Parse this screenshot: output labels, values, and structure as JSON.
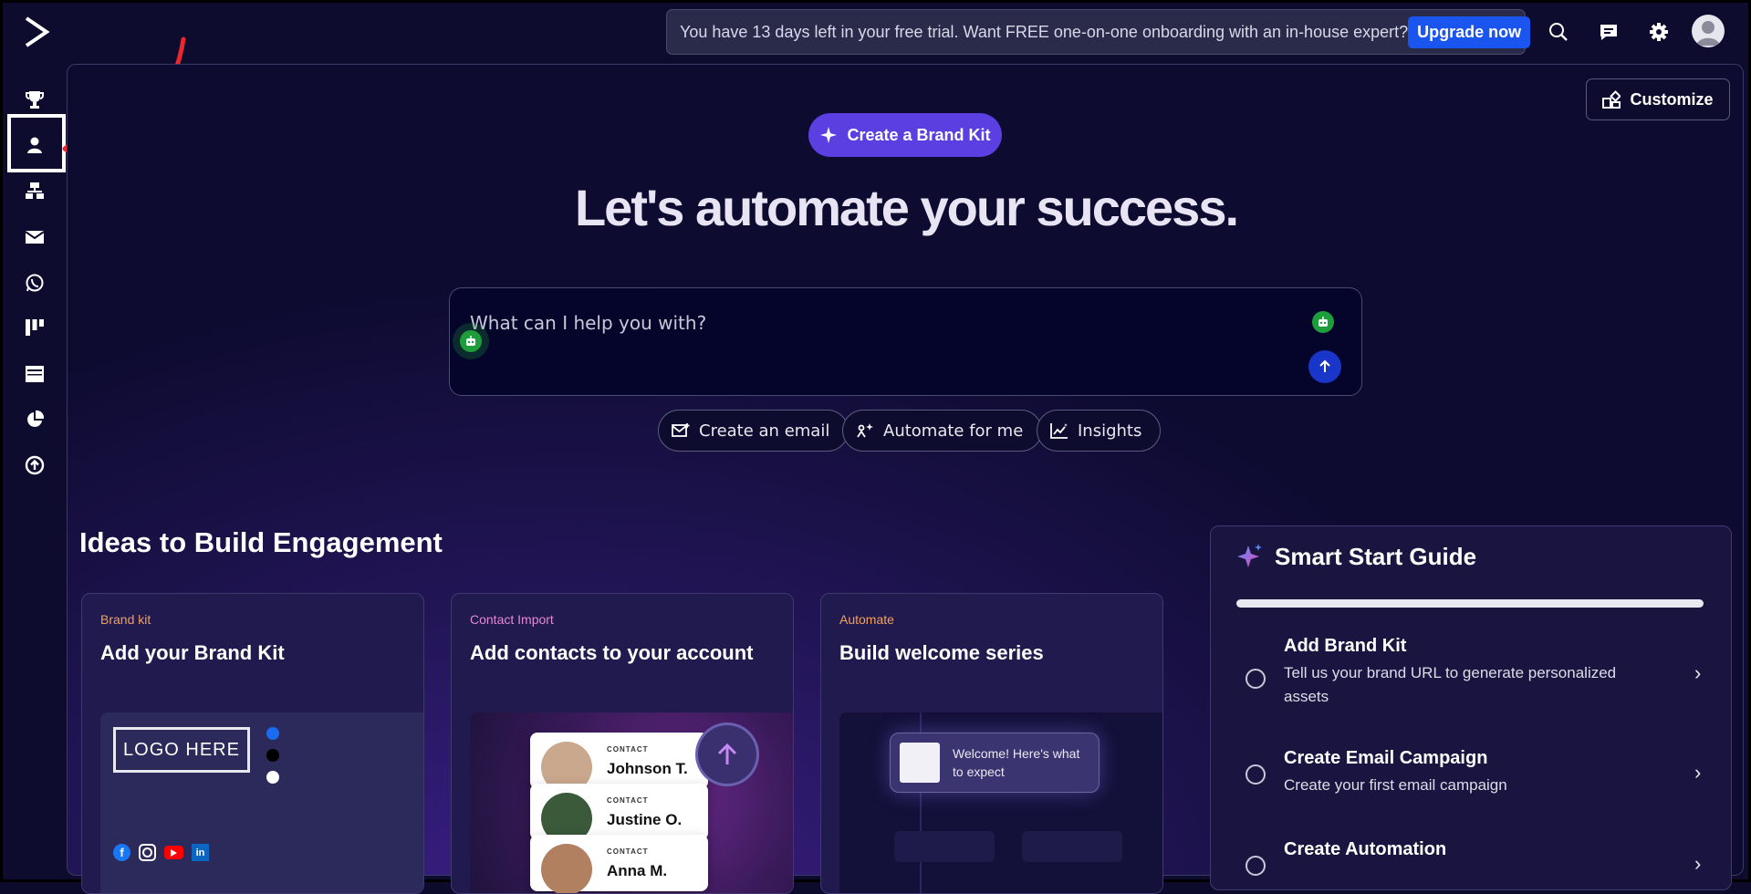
{
  "app": {
    "name": "ActiveCampaign"
  },
  "trial_banner": {
    "text": "You have 13 days left in your free trial. Want FREE one-on-one onboarding with an in-house expert?",
    "upgrade_label": "Upgrade now"
  },
  "sidebar": {
    "items": [
      {
        "icon": "trophy-icon"
      },
      {
        "icon": "contacts-icon",
        "active": true
      },
      {
        "icon": "automations-icon"
      },
      {
        "icon": "email-icon"
      },
      {
        "icon": "whatsapp-icon"
      },
      {
        "icon": "deals-icon"
      },
      {
        "icon": "website-icon"
      },
      {
        "icon": "reports-icon"
      },
      {
        "icon": "upgrade-icon"
      }
    ]
  },
  "toolbar": {
    "customize_label": "Customize"
  },
  "hero": {
    "brand_kit_button": "Create a Brand Kit",
    "headline": "Let's automate your success.",
    "prompt_placeholder": "What can I help you with?",
    "chips": [
      "Create an email",
      "Automate for me",
      "Insights"
    ]
  },
  "ideas": {
    "title": "Ideas to Build Engagement",
    "cards": [
      {
        "tag": "Brand kit",
        "title": "Add your Brand Kit",
        "logo_text": "LOGO HERE",
        "swatches": [
          "#1a6bf0",
          "#000000",
          "#ffffff"
        ]
      },
      {
        "tag": "Contact Import",
        "title": "Add contacts to your account",
        "contacts": [
          {
            "tag": "CONTACT",
            "name": "Johnson T."
          },
          {
            "tag": "CONTACT",
            "name": "Justine O."
          },
          {
            "tag": "CONTACT",
            "name": "Anna M."
          }
        ]
      },
      {
        "tag": "Automate",
        "title": "Build welcome series",
        "preview_text": "Welcome! Here's what to expect"
      }
    ]
  },
  "guide": {
    "title": "Smart Start Guide",
    "tasks": [
      {
        "title": "Add Brand Kit",
        "desc": "Tell us your brand URL to generate personalized assets"
      },
      {
        "title": "Create Email Campaign",
        "desc": "Create your first email campaign"
      },
      {
        "title": "Create Automation",
        "desc": ""
      }
    ]
  },
  "colors": {
    "accent": "#1a55f0",
    "brand_pill": "#5b3fe0",
    "annotation": "#e8282c"
  }
}
